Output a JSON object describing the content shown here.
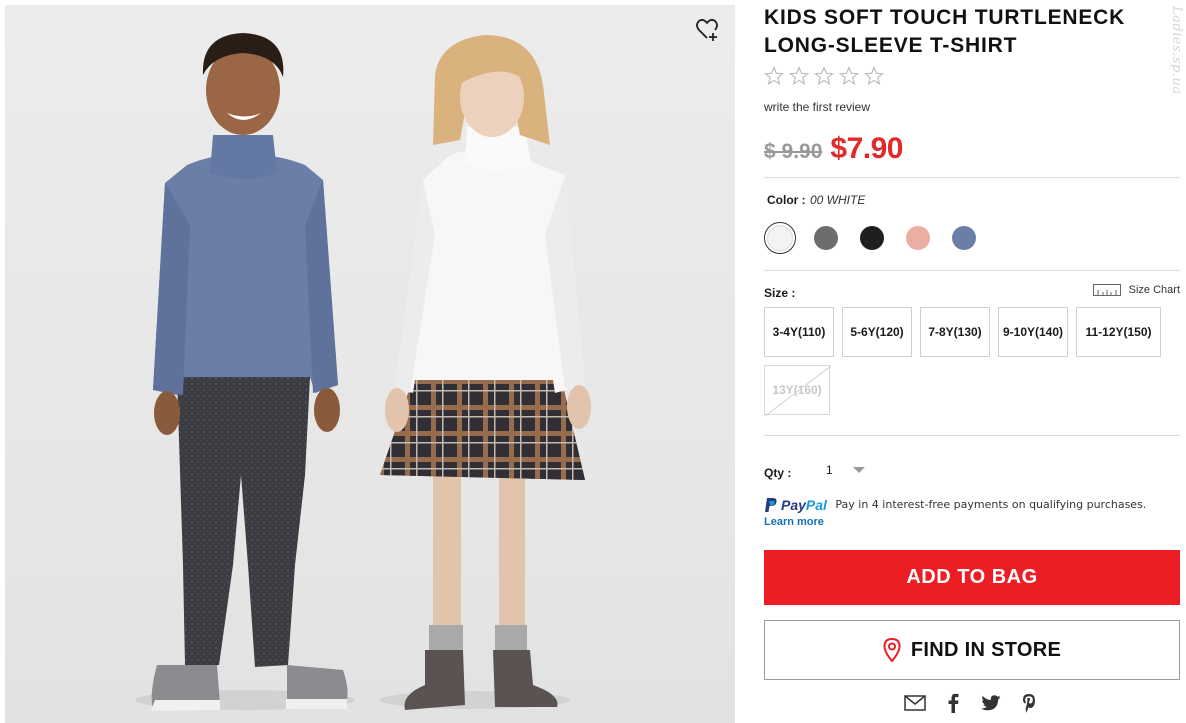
{
  "product": {
    "title": "KIDS SOFT TOUCH TURTLENECK LONG-SLEEVE T-SHIRT",
    "rating_stars": 5,
    "rating_value": 0,
    "review_link": "write the first review",
    "price_original": "$ 9.90",
    "price_sale": "$7.90",
    "image_alt_icon": "heart-plus-icon"
  },
  "color": {
    "label": "Color :",
    "selected": "00 WHITE",
    "swatches": [
      {
        "name": "white",
        "hex": "#f4f4f4"
      },
      {
        "name": "gray",
        "hex": "#6d6d6d"
      },
      {
        "name": "black",
        "hex": "#1f1f1f"
      },
      {
        "name": "pink",
        "hex": "#eaaea3"
      },
      {
        "name": "blue",
        "hex": "#6a7ea8"
      }
    ]
  },
  "size": {
    "label": "Size :",
    "chart_label": "Size Chart",
    "options": [
      {
        "label": "3-4Y(110)",
        "available": true
      },
      {
        "label": "5-6Y(120)",
        "available": true
      },
      {
        "label": "7-8Y(130)",
        "available": true
      },
      {
        "label": "9-10Y(140)",
        "available": true
      },
      {
        "label": "11-12Y(150)",
        "available": true
      },
      {
        "label": "13Y(160)",
        "available": false
      }
    ]
  },
  "qty": {
    "label": "Qty :",
    "value": "1"
  },
  "paypal": {
    "brand_a": "Pay",
    "brand_b": "Pal",
    "text": "Pay in 4 interest-free payments on qualifying purchases.",
    "learn_more": "Learn more"
  },
  "actions": {
    "add_to_bag": "ADD TO BAG",
    "find_in_store": "FIND IN STORE"
  },
  "share": [
    "mail-icon",
    "facebook-icon",
    "twitter-icon",
    "pinterest-icon"
  ],
  "watermark": "Ladies.sp.ua",
  "colors": {
    "accent_red": "#ed1d24",
    "sale_price": "#e32a2a",
    "paypal_dark": "#253b80",
    "paypal_light": "#179bd7"
  }
}
